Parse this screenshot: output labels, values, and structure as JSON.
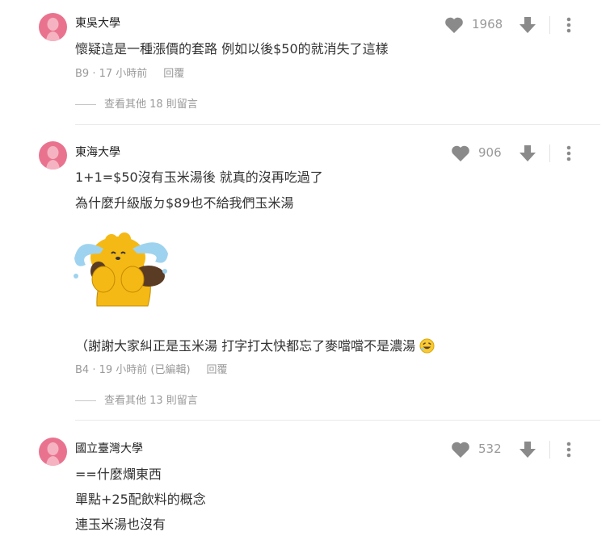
{
  "comments": [
    {
      "school": "東吳大學",
      "lines": [
        "懷疑這是一種漲價的套路 例如以後$50的就消失了這樣"
      ],
      "floor_time": "B9 · 17 小時前",
      "reply_label": "回覆",
      "likes": "1968",
      "more_replies": "查看其他 18 則留言"
    },
    {
      "school": "東海大學",
      "lines": [
        "1+1=$50沒有玉米湯後 就真的沒再吃過了",
        "為什麼升級版ㄉ$89也不給我們玉米湯"
      ],
      "note": "（謝謝大家糾正是玉米湯 打字打太快都忘了麥噹噹不是濃湯",
      "floor_time": "B4 · 19 小時前 (已編輯)",
      "reply_label": "回覆",
      "likes": "906",
      "more_replies": "查看其他 13 則留言"
    },
    {
      "school": "國立臺灣大學",
      "lines": [
        "==什麼爛東西",
        "單點+25配飲料的概念",
        "連玉米湯也沒有"
      ],
      "likes": "532"
    }
  ],
  "colors": {
    "avatar": "#e9738f",
    "icon": "#8a8a8a",
    "sticker": "#f5b915",
    "tears": "#9ed3ef"
  }
}
